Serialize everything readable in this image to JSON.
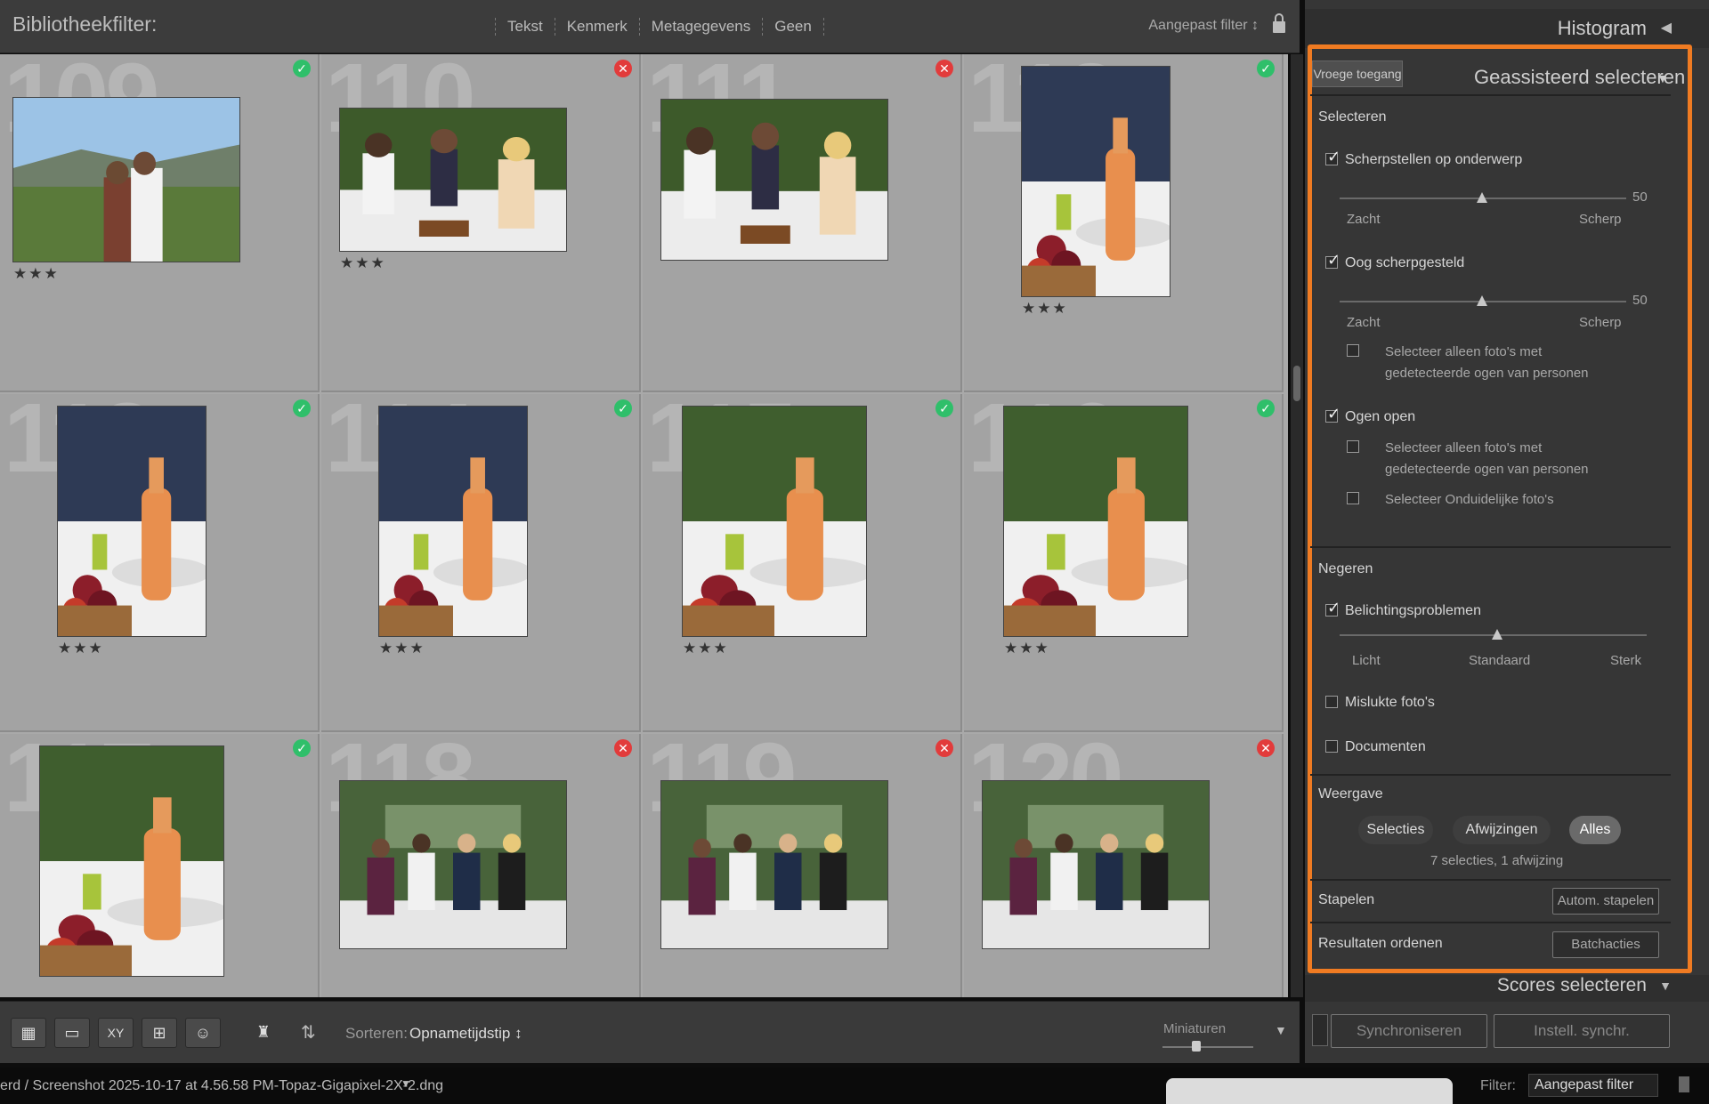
{
  "filterbar": {
    "title": "Bibliotheekfilter:",
    "tabs": [
      "Tekst",
      "Kenmerk",
      "Metagegevens",
      "Geen"
    ],
    "preset": "Aangepast filter ↕"
  },
  "grid": {
    "cells": [
      {
        "num": "109",
        "flag": "pick",
        "stars": "★★★",
        "scene": "vineyard"
      },
      {
        "num": "110",
        "flag": "reject",
        "stars": "★★★",
        "scene": "toast"
      },
      {
        "num": "111",
        "flag": "reject",
        "stars": "",
        "scene": "toast2"
      },
      {
        "num": "112",
        "flag": "pick",
        "stars": "★★★",
        "scene": "bottle"
      },
      {
        "num": "113",
        "flag": "pick",
        "stars": "★★★",
        "scene": "bottle"
      },
      {
        "num": "114",
        "flag": "pick",
        "stars": "★★★",
        "scene": "bottle"
      },
      {
        "num": "115",
        "flag": "pick",
        "stars": "★★★",
        "scene": "bottle2"
      },
      {
        "num": "116",
        "flag": "pick",
        "stars": "★★★",
        "scene": "bottle2"
      },
      {
        "num": "117",
        "flag": "pick",
        "stars": "",
        "scene": "bottle2"
      },
      {
        "num": "118",
        "flag": "reject",
        "stars": "",
        "scene": "group"
      },
      {
        "num": "119",
        "flag": "reject",
        "stars": "",
        "scene": "group"
      },
      {
        "num": "120",
        "flag": "reject",
        "stars": "",
        "scene": "group"
      }
    ]
  },
  "toolbar": {
    "sort_label": "Sorteren:",
    "sort_value": "Opnametijdstip ↕",
    "thumb_label": "Miniaturen",
    "view_icons": [
      "grid-view-icon",
      "loupe-view-icon",
      "compare-view-icon",
      "survey-view-icon",
      "people-view-icon"
    ]
  },
  "panel": {
    "histogram": "Histogram",
    "early_access": "Vroege toegang",
    "assisted_title": "Geassisteerd selecteren",
    "select_heading": "Selecteren",
    "focus_label": "Scherpstellen op onderwerp",
    "focus_value": "50",
    "focus_low": "Zacht",
    "focus_high": "Scherp",
    "eye_label": "Oog scherpgesteld",
    "eye_value": "50",
    "eye_low": "Zacht",
    "eye_high": "Scherp",
    "eye_only_line1": "Selecteer alleen foto's met",
    "eye_only_line2": "gedetecteerde ogen van personen",
    "open_label": "Ogen open",
    "open_only_line1": "Selecteer alleen foto's met",
    "open_only_line2": "gedetecteerde ogen van personen",
    "unclear_label": "Selecteer Onduidelijke foto's",
    "ignore_heading": "Negeren",
    "exposure_label": "Belichtingsproblemen",
    "exposure_low": "Licht",
    "exposure_mid": "Standaard",
    "exposure_high": "Sterk",
    "failed_label": "Mislukte foto's",
    "documents_label": "Documenten",
    "view_heading": "Weergave",
    "view_picks": "Selecties",
    "view_rejects": "Afwijzingen",
    "view_all": "Alles",
    "summary": "7 selecties, 1 afwijzing",
    "stack_label": "Stapelen",
    "stack_button": "Autom. stapelen",
    "sort_results_label": "Resultaten ordenen",
    "batch_button": "Batchacties",
    "scores_title": "Scores selecteren",
    "sync_button": "Synchroniseren",
    "sync_settings_button": "Instell. synchr."
  },
  "checks": {
    "focus": true,
    "eye": true,
    "eye_only": false,
    "open": true,
    "open_only": false,
    "unclear": false,
    "exposure": true,
    "failed": false,
    "documents": false
  },
  "status": {
    "path": "erd / Screenshot 2025-10-17 at 4.56.58 PM-Topaz-Gigapixel-2X-2.dng",
    "filter_label": "Filter:",
    "filter_value": "Aangepast filter"
  },
  "colors": {
    "accent": "#f07b22",
    "pick": "#2fbf6a",
    "reject": "#e23b3b"
  }
}
